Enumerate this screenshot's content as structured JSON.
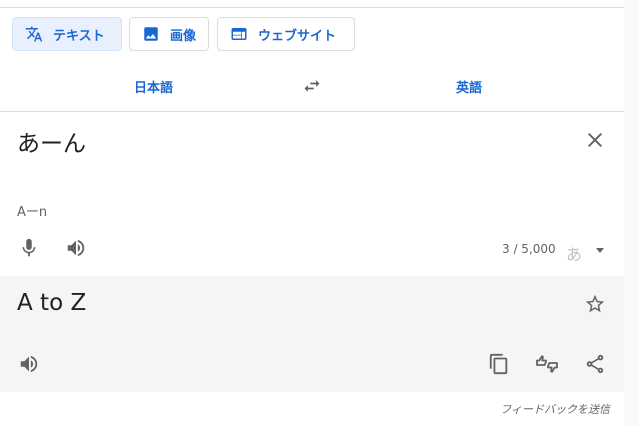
{
  "modes": [
    {
      "label": "テキスト",
      "icon": "translate-icon"
    },
    {
      "label": "画像",
      "icon": "image-icon"
    },
    {
      "label": "ウェブサイト",
      "icon": "website-icon"
    }
  ],
  "languages": {
    "source": "日本語",
    "target": "英語",
    "swap_icon": "swap-icon"
  },
  "source": {
    "text": "あーん",
    "transliteration": "Aーn",
    "char_count": "3 / 5,000",
    "input_tool": "あ"
  },
  "target": {
    "text": "A to Z"
  },
  "feedback_link": "フィードバックを送信",
  "colors": {
    "accent": "#1967d2",
    "active_tab_bg": "#e8f0fe",
    "target_panel_bg": "#f5f5f5",
    "icon": "#5f6368"
  }
}
